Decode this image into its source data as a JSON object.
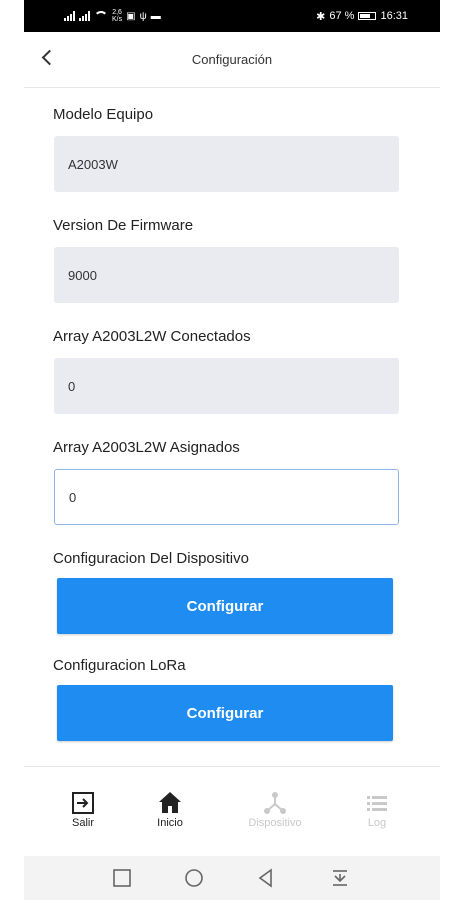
{
  "status_bar": {
    "network_speed_top": "2,6",
    "network_speed_bottom": "K/s",
    "battery": "67 %",
    "time": "16:31",
    "bluetooth_symbol": "✱"
  },
  "header": {
    "title": "Configuración",
    "back_icon": "chevron-left-icon"
  },
  "form": {
    "fields": [
      {
        "label": "Modelo Equipo",
        "value": "A2003W"
      },
      {
        "label": "Version De Firmware",
        "value": "9000"
      },
      {
        "label": "Array A2003L2W Conectados",
        "value": "0"
      },
      {
        "label": "Array A2003L2W Asignados",
        "value": "0"
      }
    ],
    "device_config": {
      "label": "Configuracion Del Dispositivo",
      "button": "Configurar"
    },
    "lora_config": {
      "label": "Configuracion LoRa",
      "button": "Configurar"
    }
  },
  "bottom_nav": {
    "items": [
      {
        "label": "Salir",
        "icon": "logout-icon"
      },
      {
        "label": "Inicio",
        "icon": "home-icon"
      },
      {
        "label": "Dispositivo",
        "icon": "device-network-icon"
      },
      {
        "label": "Log",
        "icon": "list-icon"
      }
    ]
  },
  "colors": {
    "accent": "#1f8cf2",
    "field_bg": "#e9ebf1",
    "active_border": "#8fb6e8",
    "disabled": "#c9c9c9"
  }
}
